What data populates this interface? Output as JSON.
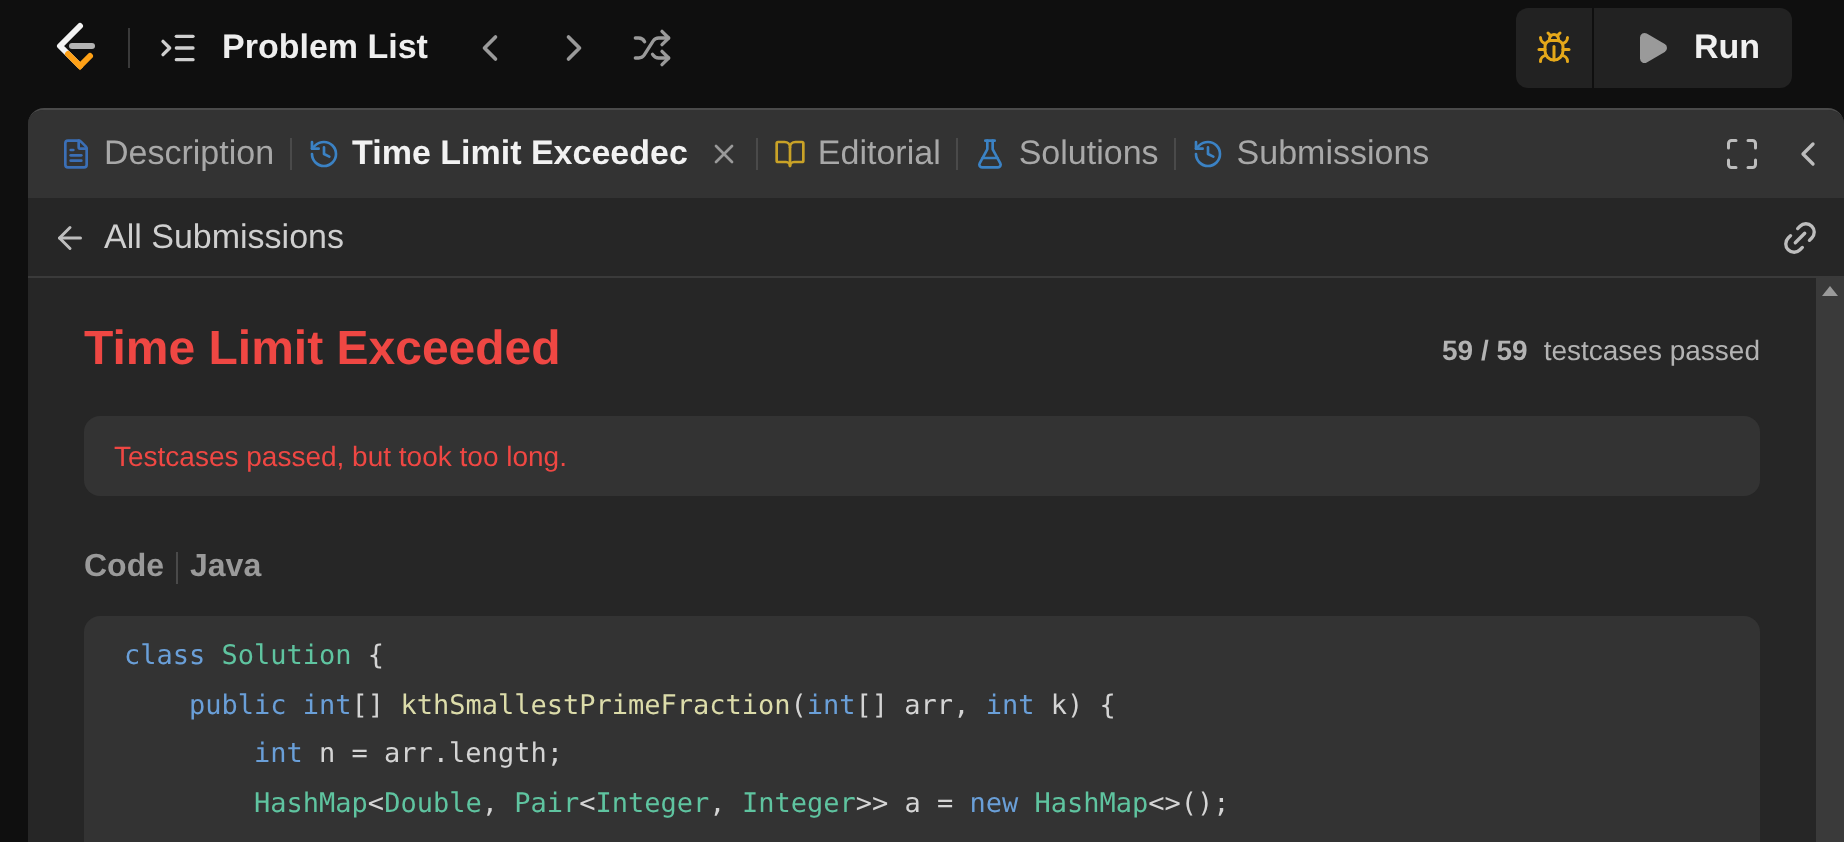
{
  "top_bar": {
    "title": "Problem List",
    "run_button": "Run"
  },
  "tabs": [
    {
      "kind": "description",
      "label": "Description",
      "selected": false,
      "closable": false
    },
    {
      "kind": "history",
      "label": "Time Limit Exceedec",
      "selected": true,
      "closable": true
    },
    {
      "kind": "editorial",
      "label": "Editorial",
      "selected": false,
      "closable": false
    },
    {
      "kind": "solutions",
      "label": "Solutions",
      "selected": false,
      "closable": false
    },
    {
      "kind": "history",
      "label": "Submissions",
      "selected": false,
      "closable": false
    }
  ],
  "back_link": "All Submissions",
  "result": {
    "status": "Time Limit Exceeded",
    "passed": "59 / 59",
    "passed_label": "testcases passed",
    "message": "Testcases passed, but took too long."
  },
  "code_header": {
    "label": "Code",
    "language": "Java"
  },
  "code_lines": [
    [
      {
        "kind": "keyword",
        "text": "class"
      },
      {
        "kind": "type",
        "text": " Solution"
      },
      {
        "kind": "plain",
        "text": " {"
      }
    ],
    [
      {
        "kind": "keyword",
        "text": "    public"
      },
      {
        "kind": "keyword",
        "text": " int"
      },
      {
        "kind": "plain",
        "text": "[] "
      },
      {
        "kind": "func",
        "text": "kthSmallestPrimeFraction"
      },
      {
        "kind": "plain",
        "text": "("
      },
      {
        "kind": "keyword",
        "text": "int"
      },
      {
        "kind": "plain",
        "text": "[] arr, "
      },
      {
        "kind": "keyword",
        "text": "int"
      },
      {
        "kind": "plain",
        "text": " k) {"
      }
    ],
    [
      {
        "kind": "keyword",
        "text": "        int"
      },
      {
        "kind": "plain",
        "text": " n = arr.length;"
      }
    ],
    [
      {
        "kind": "type",
        "text": "        HashMap"
      },
      {
        "kind": "plain",
        "text": "<"
      },
      {
        "kind": "type",
        "text": "Double"
      },
      {
        "kind": "plain",
        "text": ", "
      },
      {
        "kind": "type",
        "text": "Pair"
      },
      {
        "kind": "plain",
        "text": "<"
      },
      {
        "kind": "type",
        "text": "Integer"
      },
      {
        "kind": "plain",
        "text": ", "
      },
      {
        "kind": "type",
        "text": "Integer"
      },
      {
        "kind": "plain",
        "text": ">> a = "
      },
      {
        "kind": "keyword",
        "text": "new"
      },
      {
        "kind": "type",
        "text": " HashMap"
      },
      {
        "kind": "plain",
        "text": "<>();"
      }
    ]
  ]
}
